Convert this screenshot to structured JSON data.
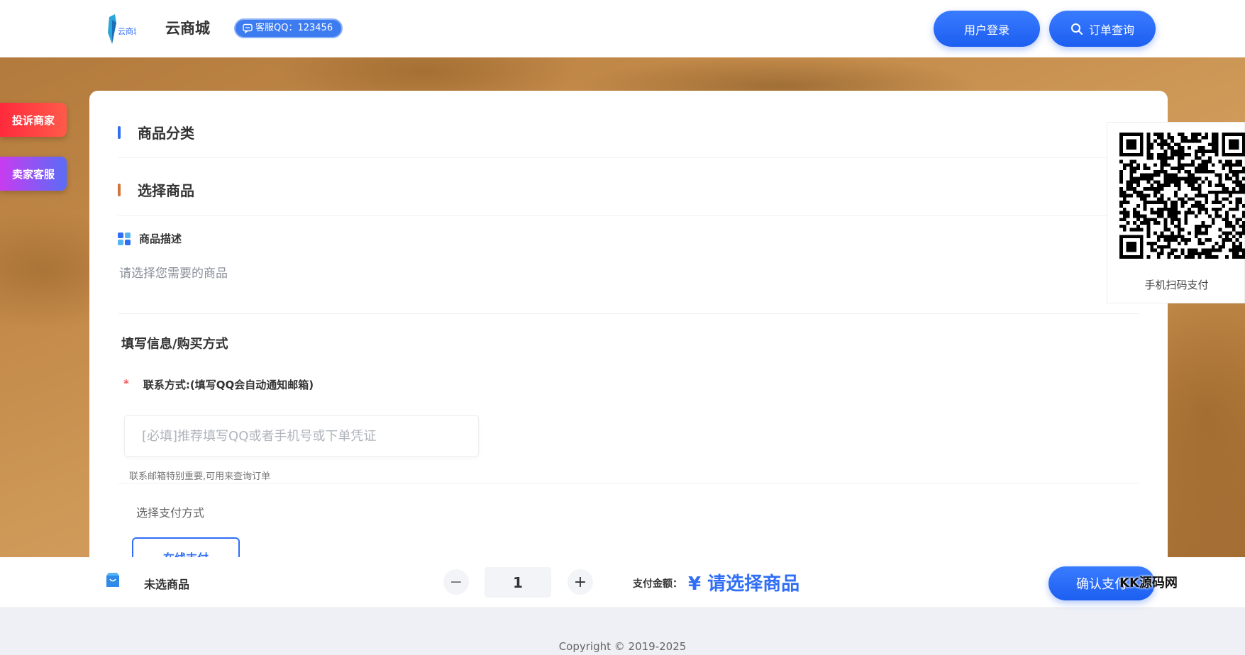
{
  "header": {
    "site_name": "云商城",
    "logo_text": "云商城",
    "qq_badge": "客服QQ：123456",
    "login_button": "用户登录",
    "order_query_button": "订单查询"
  },
  "side_tags": {
    "complain": "投诉商家",
    "seller_service": "卖家客服"
  },
  "main": {
    "category_title": "商品分类",
    "select_goods_title": "选择商品",
    "description_title": "商品描述",
    "description_text": "请选择您需要的商品",
    "fill_info_title": "填写信息/购买方式",
    "contact_required_mark": "*",
    "contact_label": "联系方式:(填写QQ会自动通知邮箱)",
    "contact_placeholder": "[必填]推荐填写QQ或者手机号或下单凭证",
    "contact_hint": "联系邮箱特别重要,可用来查询订单",
    "pay_method_label": "选择支付方式",
    "pay_option": "在线支付"
  },
  "qr": {
    "caption": "手机扫码支付"
  },
  "bottom_bar": {
    "selected_item": "未选商品",
    "quantity": "1",
    "minus": "−",
    "plus": "+",
    "amount_label": "支付金额：",
    "amount_value": "¥ 请选择商品",
    "confirm_button": "确认支付",
    "watermark": "KK源码网"
  },
  "footer": {
    "copyright": "Copyright © 2019-2025"
  },
  "colors": {
    "accent": "#2f6ef5",
    "category_bar": "#2f6ef5",
    "goods_bar": "#d4733a",
    "complain_tag": "#ff2a3c",
    "service_tag": "#a84cf2"
  }
}
